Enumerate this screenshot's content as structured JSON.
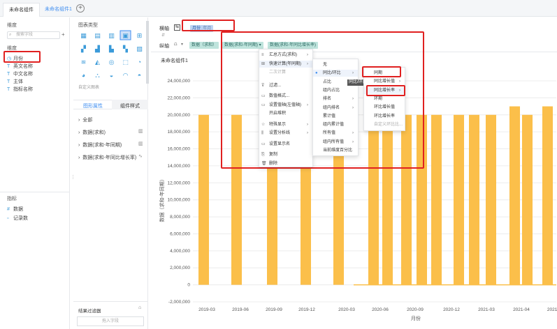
{
  "tabs": [
    {
      "label": "未命名组件"
    },
    {
      "label": "未命名组件1"
    }
  ],
  "left": {
    "dim_title": "维度",
    "search_placeholder": "搜索字段",
    "dims": [
      "月份",
      "英文名称",
      "中文名称",
      "主体",
      "指标名称"
    ],
    "measure_title": "指标",
    "measures": [
      "数据",
      "记录数"
    ]
  },
  "charttype": {
    "title": "图表类型",
    "custom": "自定义图表"
  },
  "attr": {
    "tab_graphic": "图形属性",
    "tab_component": "组件样式",
    "items": [
      "全部",
      "数据(求和)",
      "数据(求和-年同期)",
      "数据(求和-年同比增长率)"
    ]
  },
  "filter": {
    "title": "结果过滤器",
    "placeholder": "拖入字段"
  },
  "axes": {
    "h_label": "横轴",
    "v_label": "纵轴",
    "h_pill_main": "月份",
    "h_pill_sub": "年月",
    "v_pills": [
      "数据（求和）",
      "数据(求和-年同期)",
      "数据(求和-年同比增长率)"
    ]
  },
  "chart_title": "未命名组件1",
  "menu1": [
    {
      "label": "汇总方式(求和)",
      "arrow": true,
      "icon": "≡"
    },
    {
      "label": "快速计算(年同期)",
      "arrow": true,
      "icon": "⊞"
    },
    {
      "label": "二次计算",
      "arrow": false,
      "icon": "",
      "disabled": true
    },
    {
      "label": "过滤...",
      "arrow": false,
      "icon": "⊽"
    },
    {
      "label": "数值格式...",
      "arrow": false,
      "icon": "▭"
    },
    {
      "label": "设置值轴(左值轴)",
      "arrow": true,
      "icon": "▭"
    },
    {
      "label": "开启堆积",
      "arrow": false,
      "icon": ""
    },
    {
      "label": "特殊显示",
      "arrow": true,
      "icon": "☆"
    },
    {
      "label": "设置分析线",
      "arrow": true,
      "icon": "⫼"
    },
    {
      "label": "设置显示名",
      "arrow": false,
      "icon": "▭"
    },
    {
      "label": "复制",
      "arrow": false,
      "icon": "⎘"
    },
    {
      "label": "删除",
      "arrow": false,
      "icon": "🗑"
    }
  ],
  "menu2": [
    {
      "label": "无",
      "arrow": false
    },
    {
      "label": "同比/环比",
      "arrow": true,
      "selected": true
    },
    {
      "label": "占比",
      "arrow": false
    },
    {
      "label": "组内占比",
      "arrow": false
    },
    {
      "label": "排名",
      "arrow": true
    },
    {
      "label": "组内排名",
      "arrow": true
    },
    {
      "label": "累计值",
      "arrow": false
    },
    {
      "label": "组内累计值",
      "arrow": false
    },
    {
      "label": "所有值",
      "arrow": true
    },
    {
      "label": "组内所有值",
      "arrow": true
    },
    {
      "label": "当前维度百分比",
      "arrow": false
    }
  ],
  "tooltip": "同比/环比",
  "menu3": [
    {
      "label": "同期",
      "arrow": false
    },
    {
      "label": "同比增长值",
      "arrow": true
    },
    {
      "label": "同比增长率",
      "arrow": true
    },
    {
      "label": "环期",
      "arrow": false
    },
    {
      "label": "环比增长值",
      "arrow": false
    },
    {
      "label": "环比增长率",
      "arrow": false
    },
    {
      "label": "自定义环比比...",
      "arrow": false,
      "disabled": true
    }
  ],
  "chart_data": {
    "type": "bar",
    "title": "未命名组件1",
    "xlabel": "月份",
    "ylabel": "数据（求和-年同期）",
    "ylim": [
      -2000000,
      24000000
    ],
    "yticks": [
      -2000000,
      0,
      2000000,
      4000000,
      6000000,
      8000000,
      10000000,
      12000000,
      14000000,
      16000000,
      18000000,
      20000000,
      22000000,
      24000000
    ],
    "ytick_labels": [
      "-2,000,000",
      "0",
      "2,000,000",
      "4,000,000",
      "6,000,000",
      "8,000,000",
      "10,000,000",
      "12,000,000",
      "14,000,000",
      "16,000,000",
      "18,000,000",
      "20,000,000",
      "22,000,000",
      "24,000,000"
    ],
    "xtick_labels": [
      "2019-03",
      "2019-06",
      "2019-09",
      "2019-12",
      "2020-03",
      "2020-06",
      "2020-09",
      "2020-12",
      "2021-03",
      "2021-04",
      "2021-0"
    ],
    "categories": [
      "2019-03",
      "2019-06",
      "2019-09",
      "2019-12",
      "2020-03",
      "2020-04",
      "2020-05",
      "2020-06",
      "2020-07",
      "2020-08",
      "2020-09",
      "2020-10",
      "2020-11",
      "2020-12",
      "2021-01",
      "2021-02",
      "2021-03",
      "2021-04",
      "2021-05"
    ],
    "values": [
      20000000,
      20000000,
      20000000,
      20000000,
      20000000,
      20000000,
      20000000,
      20000000,
      20000000,
      20000000,
      20000000,
      20000000,
      20000000,
      21000000,
      20000000,
      21000000,
      20000000,
      0,
      0
    ]
  }
}
